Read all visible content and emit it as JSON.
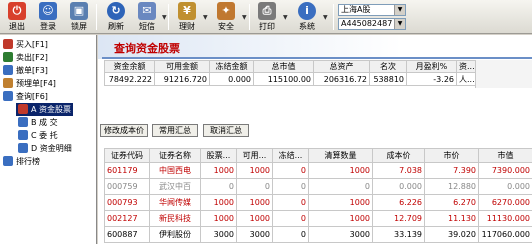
{
  "toolbar": {
    "buttons": [
      {
        "label": "退出",
        "icon": "exit-icon",
        "color": "#d8402c"
      },
      {
        "label": "登录",
        "icon": "login-icon",
        "color": "#3a6ec0"
      },
      {
        "label": "锁屏",
        "icon": "lock-icon",
        "color": "#5a7fb0"
      },
      {
        "label": "刷新",
        "icon": "refresh-icon",
        "color": "#2e64b8"
      },
      {
        "label": "短信",
        "icon": "message-icon",
        "color": "#6a88c0"
      },
      {
        "label": "理财",
        "icon": "finance-icon",
        "color": "#c09030"
      },
      {
        "label": "安全",
        "icon": "security-icon",
        "color": "#c07830"
      },
      {
        "label": "打印",
        "icon": "print-icon",
        "color": "#7a7a7a"
      },
      {
        "label": "系统",
        "icon": "system-icon",
        "color": "#3a6ec0"
      }
    ],
    "market_select": "上海A股",
    "account_select": "A445082487"
  },
  "nav": {
    "items": [
      {
        "label": "买入[F1]",
        "icon": "buy-icon",
        "color": "#c0392b"
      },
      {
        "label": "卖出[F2]",
        "icon": "sell-icon",
        "color": "#2e7d32"
      },
      {
        "label": "撤单[F3]",
        "icon": "cancel-order-icon",
        "color": "#3a6ec0"
      },
      {
        "label": "预埋单[F4]",
        "icon": "preorder-icon",
        "color": "#c08030"
      },
      {
        "label": "查询[F6]",
        "icon": "query-icon",
        "color": "#3a6ec0"
      },
      {
        "label": "资金股票",
        "prefix": "A",
        "icon": "fund-stock-icon",
        "color": "#c0392b"
      },
      {
        "label": "成    交",
        "prefix": "B",
        "icon": "deal-icon",
        "color": "#3a6ec0"
      },
      {
        "label": "委    托",
        "prefix": "C",
        "icon": "entrust-icon",
        "color": "#3a6ec0"
      },
      {
        "label": "资金明细",
        "prefix": "D",
        "icon": "fund-detail-icon",
        "color": "#3a6ec0"
      },
      {
        "label": "排行榜",
        "icon": "ranking-icon",
        "color": "#3a6ec0"
      }
    ]
  },
  "main": {
    "title": "查询资金股票",
    "fund_headers": [
      "资金余额",
      "可用金额",
      "冻结金额",
      "总市值",
      "总资产",
      "名次",
      "月盈利%",
      "资..."
    ],
    "fund_values": [
      "78492.222",
      "91216.720",
      "0.000",
      "115100.00",
      "206316.72",
      "538810",
      "-3.26",
      "人..."
    ],
    "buttons": [
      "修改成本价",
      "常用汇总",
      "取消汇总"
    ],
    "hold_headers": [
      "证券代码",
      "证券名称",
      "股票...",
      "可用...",
      "冻结...",
      "清算数量",
      "成本价",
      "市价",
      "市值"
    ],
    "hold_rows": [
      [
        "601179",
        "中国西电",
        "1000",
        "1000",
        "0",
        "1000",
        "7.038",
        "7.390",
        "7390.000"
      ],
      [
        "000759",
        "武汉中百",
        "0",
        "0",
        "0",
        "0",
        "0.000",
        "12.880",
        "0.000"
      ],
      [
        "000793",
        "华闻传媒",
        "1000",
        "1000",
        "0",
        "1000",
        "6.226",
        "6.270",
        "6270.000"
      ],
      [
        "002127",
        "新民科技",
        "1000",
        "1000",
        "0",
        "1000",
        "12.709",
        "11.130",
        "11130.000"
      ],
      [
        "600887",
        "伊利股份",
        "3000",
        "3000",
        "0",
        "3000",
        "33.139",
        "39.020",
        "117060.000"
      ]
    ],
    "hold_row_colors": [
      "#c00000",
      "#888888",
      "#c00000",
      "#c00000",
      "#000000"
    ]
  }
}
